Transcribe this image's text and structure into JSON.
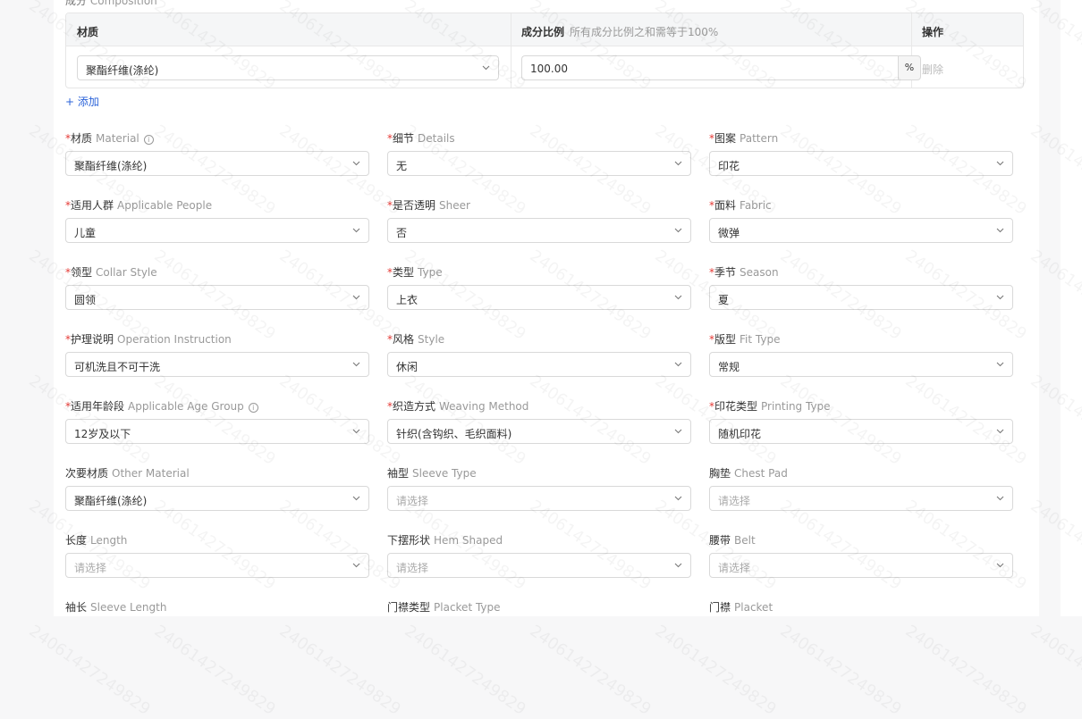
{
  "composition": {
    "section_cn": "成分",
    "section_en": "Composition",
    "headers": {
      "material": "材质",
      "ratio": "成分比例",
      "ratio_hint": "所有成分比例之和需等于100%",
      "action": "操作"
    },
    "row": {
      "material": "聚酯纤维(涤纶)",
      "ratio": "100.00",
      "unit": "%",
      "delete": "删除"
    },
    "add": "+ 添加"
  },
  "fields": [
    {
      "cn": "材质",
      "en": "Material",
      "required": "*",
      "info": "i",
      "value": "聚酯纤维(涤纶)"
    },
    {
      "cn": "细节",
      "en": "Details",
      "required": "*",
      "value": "无"
    },
    {
      "cn": "图案",
      "en": "Pattern",
      "required": "*",
      "value": "印花"
    },
    {
      "cn": "适用人群",
      "en": "Applicable People",
      "required": "*",
      "value": "儿童"
    },
    {
      "cn": "是否透明",
      "en": "Sheer",
      "required": "*",
      "value": "否"
    },
    {
      "cn": "面料",
      "en": "Fabric",
      "required": "*",
      "value": "微弹"
    },
    {
      "cn": "领型",
      "en": "Collar Style",
      "required": "*",
      "value": "圆领"
    },
    {
      "cn": "类型",
      "en": "Type",
      "required": "*",
      "value": "上衣"
    },
    {
      "cn": "季节",
      "en": "Season",
      "required": "*",
      "value": "夏"
    },
    {
      "cn": "护理说明",
      "en": "Operation Instruction",
      "required": "*",
      "value": "可机洗且不可干洗"
    },
    {
      "cn": "风格",
      "en": "Style",
      "required": "*",
      "value": "休闲"
    },
    {
      "cn": "版型",
      "en": "Fit Type",
      "required": "*",
      "value": "常规"
    },
    {
      "cn": "适用年龄段",
      "en": "Applicable Age Group",
      "required": "*",
      "info": "i",
      "value": "12岁及以下"
    },
    {
      "cn": "织造方式",
      "en": "Weaving Method",
      "required": "*",
      "value": "针织(含钩织、毛织面料)"
    },
    {
      "cn": "印花类型",
      "en": "Printing Type",
      "required": "*",
      "value": "随机印花"
    },
    {
      "cn": "次要材质",
      "en": "Other Material",
      "required": "",
      "value": "聚酯纤维(涤纶)"
    },
    {
      "cn": "袖型",
      "en": "Sleeve Type",
      "required": "",
      "placeholder": "请选择"
    },
    {
      "cn": "胸垫",
      "en": "Chest Pad",
      "required": "",
      "placeholder": "请选择"
    },
    {
      "cn": "长度",
      "en": "Length",
      "required": "",
      "placeholder": "请选择"
    },
    {
      "cn": "下摆形状",
      "en": "Hem Shaped",
      "required": "",
      "placeholder": "请选择"
    },
    {
      "cn": "腰带",
      "en": "Belt",
      "required": "",
      "placeholder": "请选择"
    },
    {
      "cn": "袖长",
      "en": "Sleeve Length",
      "required": ""
    },
    {
      "cn": "门襟类型",
      "en": "Placket Type",
      "required": ""
    },
    {
      "cn": "门襟",
      "en": "Placket",
      "required": ""
    }
  ],
  "watermark": "24061427249829",
  "colors": {
    "required": "#e53935",
    "link": "#2b63d9",
    "border": "#d9d9d9"
  }
}
